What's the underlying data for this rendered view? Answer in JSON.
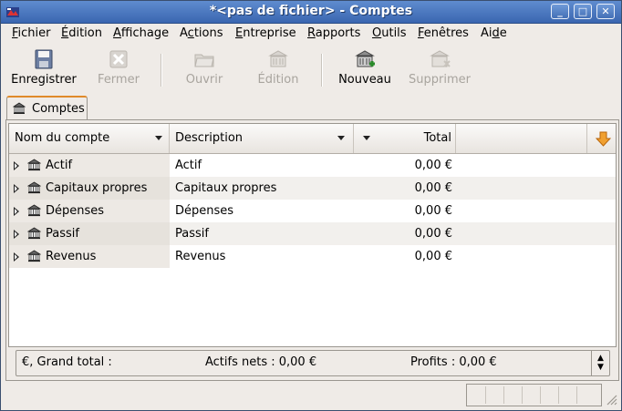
{
  "window": {
    "title": "*<pas de fichier> - Comptes",
    "controls": {
      "minimize": "_",
      "maximize": "□",
      "close": "✕"
    }
  },
  "menu": [
    {
      "label": "Fichier",
      "accel_index": 0
    },
    {
      "label": "Édition",
      "accel_index": 0
    },
    {
      "label": "Affichage",
      "accel_index": 0
    },
    {
      "label": "Actions",
      "accel_index": 1
    },
    {
      "label": "Entreprise",
      "accel_index": 0
    },
    {
      "label": "Rapports",
      "accel_index": 0
    },
    {
      "label": "Outils",
      "accel_index": 0
    },
    {
      "label": "Fenêtres",
      "accel_index": 0
    },
    {
      "label": "Aide",
      "accel_index": 2
    }
  ],
  "toolbar": {
    "save": {
      "label": "Enregistrer",
      "icon": "floppy-disk-icon",
      "enabled": true
    },
    "close": {
      "label": "Fermer",
      "icon": "close-x-icon",
      "enabled": false
    },
    "open": {
      "label": "Ouvrir",
      "icon": "open-folder-icon",
      "enabled": false
    },
    "edit": {
      "label": "Édition",
      "icon": "edit-account-icon",
      "enabled": false
    },
    "new": {
      "label": "Nouveau",
      "icon": "new-account-icon",
      "enabled": true
    },
    "delete": {
      "label": "Supprimer",
      "icon": "delete-account-icon",
      "enabled": false
    }
  },
  "tab": {
    "label": "Comptes",
    "icon": "bank-icon"
  },
  "columns": {
    "name": "Nom du compte",
    "description": "Description",
    "total": "Total"
  },
  "accounts": [
    {
      "name": "Actif",
      "description": "Actif",
      "total": "0,00 €"
    },
    {
      "name": "Capitaux propres",
      "description": "Capitaux propres",
      "total": "0,00 €"
    },
    {
      "name": "Dépenses",
      "description": "Dépenses",
      "total": "0,00 €"
    },
    {
      "name": "Passif",
      "description": "Passif",
      "total": "0,00 €"
    },
    {
      "name": "Revenus",
      "description": "Revenus",
      "total": "0,00 €"
    }
  ],
  "summary": {
    "grand_total": "€, Grand total :",
    "net_assets": "Actifs nets : 0,00 €",
    "profits": "Profits : 0,00 €"
  },
  "colors": {
    "titlebar": "#3a66b0",
    "tab_accent": "#e08a2a",
    "arrow_icon": "#f0a030"
  }
}
